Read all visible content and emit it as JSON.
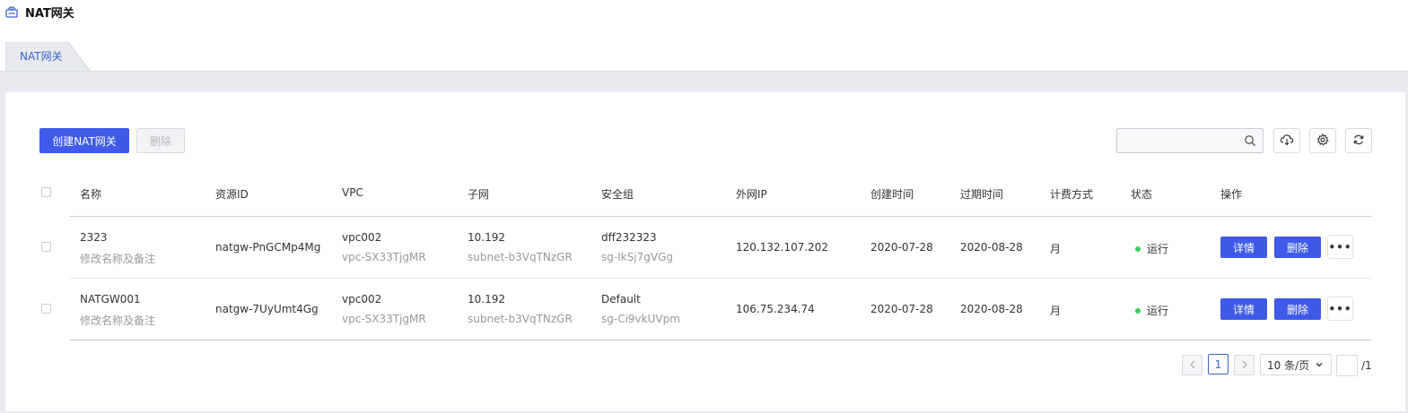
{
  "page": {
    "title": "NAT网关"
  },
  "tabs": [
    {
      "label": "NAT网关"
    }
  ],
  "toolbar": {
    "create_label": "创建NAT网关",
    "delete_label": "删除",
    "search_placeholder": "",
    "icons": [
      "cloud-download-icon",
      "gear-icon",
      "refresh-icon"
    ]
  },
  "table": {
    "headers": [
      "名称",
      "资源ID",
      "VPC",
      "子网",
      "安全组",
      "外网IP",
      "创建时间",
      "过期时间",
      "计费方式",
      "状态",
      "操作"
    ],
    "rows": [
      {
        "name": "2323",
        "remark": "修改名称及备注",
        "resource_id": "natgw-PnGCMp4Mg",
        "vpc_name": "vpc002",
        "vpc_id": "vpc-SX33TjgMR",
        "subnet_name": "10.192",
        "subnet_id": "subnet-b3VqTNzGR",
        "sg_name": "dff232323",
        "sg_id": "sg-IkSj7gVGg",
        "public_ip": "120.132.107.202",
        "created": "2020-07-28",
        "expires": "2020-08-28",
        "billing": "月",
        "status": "运行",
        "detail_label": "详情",
        "delete_label": "删除",
        "more_label": "•••"
      },
      {
        "name": "NATGW001",
        "remark": "修改名称及备注",
        "resource_id": "natgw-7UyUmt4Gg",
        "vpc_name": "vpc002",
        "vpc_id": "vpc-SX33TjgMR",
        "subnet_name": "10.192",
        "subnet_id": "subnet-b3VqTNzGR",
        "sg_name": "Default",
        "sg_id": "sg-Ci9vkUVpm",
        "public_ip": "106.75.234.74",
        "created": "2020-07-28",
        "expires": "2020-08-28",
        "billing": "月",
        "status": "运行",
        "detail_label": "详情",
        "delete_label": "删除",
        "more_label": "•••"
      }
    ]
  },
  "pagination": {
    "current": "1",
    "page_size": "10 条/页",
    "total": "/1"
  },
  "colors": {
    "primary": "#3f5ae8",
    "status_running": "#3ecb5a",
    "tab_text": "#3a63c9"
  }
}
